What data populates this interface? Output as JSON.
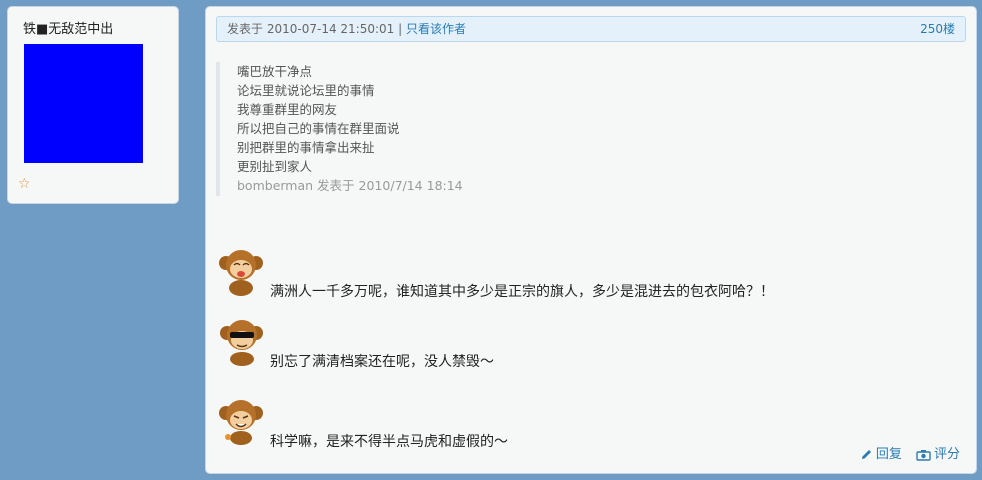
{
  "user": {
    "name": "铁■无敌范中出",
    "avatar_color": "#0000ff",
    "favorite_icon": "star-outline-icon"
  },
  "post": {
    "header": {
      "posted_label": "发表于",
      "datetime": "2010-07-14 21:50:01",
      "separator": "|",
      "author_only": "只看该作者",
      "floor": "250楼"
    },
    "quote": {
      "lines": [
        "嘴巴放干净点",
        "论坛里就说论坛里的事情",
        "我尊重群里的网友",
        "所以把自己的事情在群里面说",
        "别把群里的事情拿出来扯",
        "更别扯到家人"
      ],
      "author": "bomberman",
      "posted_label": "发表于",
      "datetime": "2010/7/14 18:14"
    },
    "messages": [
      {
        "emoji": "monkey-laugh-icon",
        "text": "满洲人一千多万呢，谁知道其中多少是正宗的旗人，多少是混进去的包衣阿哈？！"
      },
      {
        "emoji": "monkey-sunglasses-icon",
        "text": "别忘了满清档案还在呢，没人禁毁～"
      },
      {
        "emoji": "monkey-giggle-icon",
        "text": "科学嘛，是来不得半点马虎和虚假的～"
      }
    ],
    "actions": {
      "reply": "回复",
      "rate": "评分"
    }
  }
}
